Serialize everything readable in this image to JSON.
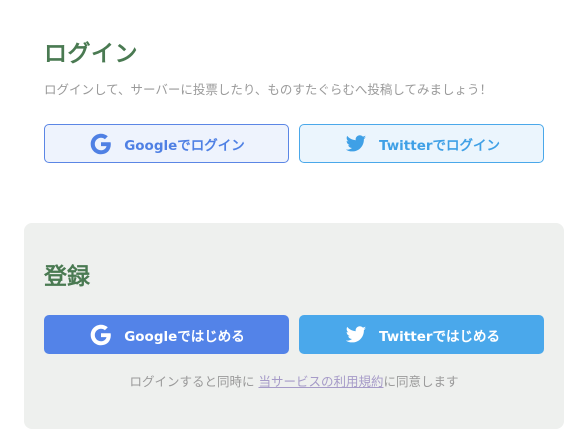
{
  "login": {
    "title": "ログイン",
    "description": "ログインして、サーバーに投票したり、ものすたぐらむへ投稿してみましょう！",
    "google_label": "Googleでログイン",
    "twitter_label": "Twitterでログイン"
  },
  "register": {
    "title": "登録",
    "google_label": "Googleではじめる",
    "twitter_label": "Twitterではじめる",
    "consent_prefix": "ログインすると同時に",
    "terms_link": "当サービスの利用規約",
    "consent_suffix": "に同意します"
  },
  "icons": {
    "google": "google-g-icon",
    "twitter": "twitter-bird-icon"
  },
  "colors": {
    "heading": "#4a7a52",
    "google_blue": "#5383e8",
    "twitter_blue": "#4aa8eb",
    "panel_bg": "#eef0ee"
  }
}
